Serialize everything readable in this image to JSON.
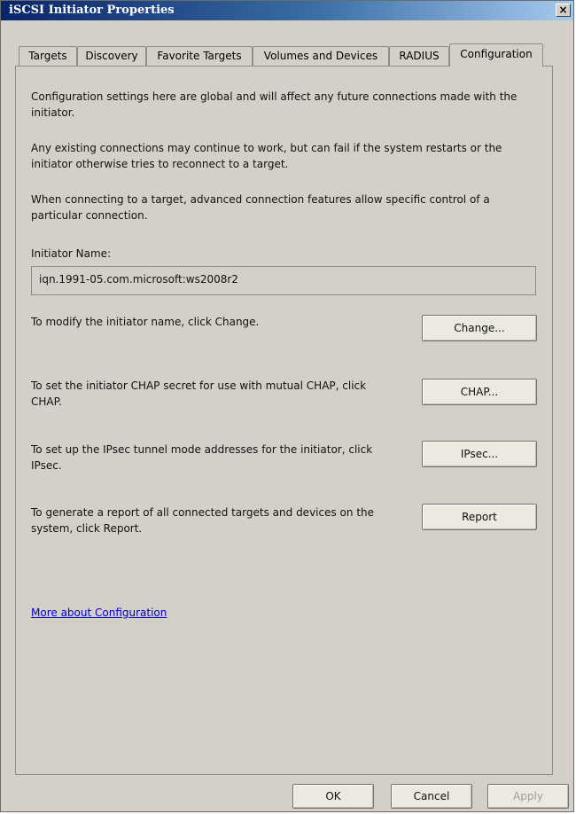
{
  "window": {
    "title": "iSCSI Initiator Properties",
    "close_glyph": "×"
  },
  "tabs": [
    {
      "label": "Targets",
      "active": false
    },
    {
      "label": "Discovery",
      "active": false
    },
    {
      "label": "Favorite Targets",
      "active": false
    },
    {
      "label": "Volumes and Devices",
      "active": false
    },
    {
      "label": "RADIUS",
      "active": false
    },
    {
      "label": "Configuration",
      "active": true
    }
  ],
  "configuration": {
    "intro1": "Configuration settings here are global and will affect any future connections made with the initiator.",
    "intro2": "Any existing connections may continue to work, but can fail if the system restarts or the initiator otherwise tries to reconnect to a target.",
    "intro3": "When connecting to a target, advanced connection features allow specific control of a particular connection.",
    "initiator_name_label": "Initiator Name:",
    "initiator_name_value": "iqn.1991-05.com.microsoft:ws2008r2",
    "change_text": "To modify the initiator name, click Change.",
    "change_button": "Change...",
    "chap_text": "To set the initiator CHAP secret for use with mutual CHAP, click CHAP.",
    "chap_button": "CHAP...",
    "ipsec_text": "To set up the IPsec tunnel mode addresses for the initiator, click IPsec.",
    "ipsec_button": "IPsec...",
    "report_text": "To generate a report of all connected targets and devices on the system, click Report.",
    "report_button": "Report",
    "more_link": "More about Configuration"
  },
  "footer": {
    "ok": "OK",
    "cancel": "Cancel",
    "apply": "Apply",
    "apply_enabled": false
  },
  "colors": {
    "titlebar_start": "#0a246a",
    "titlebar_end": "#a6caf0",
    "dialog_bg": "#d4d0c8",
    "link": "#0000cc",
    "disabled_text": "#a09c94"
  }
}
